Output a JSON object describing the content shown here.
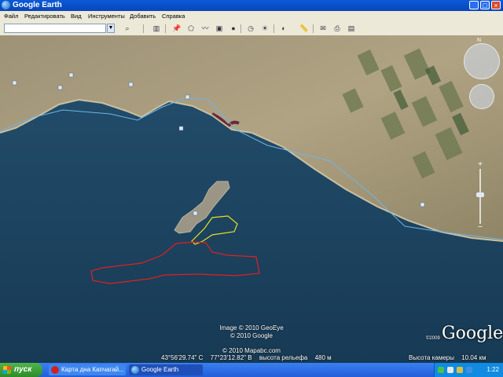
{
  "window": {
    "title": "Google Earth",
    "buttons": {
      "minimize": "_",
      "maximize": "□",
      "close": "×"
    }
  },
  "menu": [
    "Файл",
    "Редактировать",
    "Вид",
    "Инструменты",
    "Добавить",
    "Справка"
  ],
  "search": {
    "value": "",
    "placeholder": ""
  },
  "toolbar": {
    "icons": [
      "sidebar-toggle-icon",
      "placemark-icon",
      "polygon-icon",
      "path-icon",
      "image-overlay-icon",
      "record-tour-icon",
      "historical-imagery-icon",
      "sunlight-icon",
      "planets-icon",
      "ruler-icon",
      "email-icon",
      "print-icon",
      "view-in-maps-icon"
    ]
  },
  "map": {
    "attribution": [
      "Image © 2010 GeoEye",
      "© 2010 Google",
      "© 2010 Mapabc.com"
    ],
    "status": {
      "lat": "43°56'29.74\" С",
      "lon": "77°23'12.82\" В",
      "elevation_label": "высота рельефа",
      "elevation": "480 м",
      "eye_label": "Высота камеры",
      "eye": "10.04 км"
    },
    "logo": "Google",
    "copyright": "©2009",
    "colors": {
      "water": "#1e4a68",
      "land": "#a89a7c",
      "border": "#6fb4e8",
      "red_path": "#e02020",
      "yellow_path": "#e8e020"
    }
  },
  "taskbar": {
    "start": "пуск",
    "tasks": [
      "Карта дна Капчагай...",
      "Google Earth"
    ],
    "clock": "1:22"
  }
}
